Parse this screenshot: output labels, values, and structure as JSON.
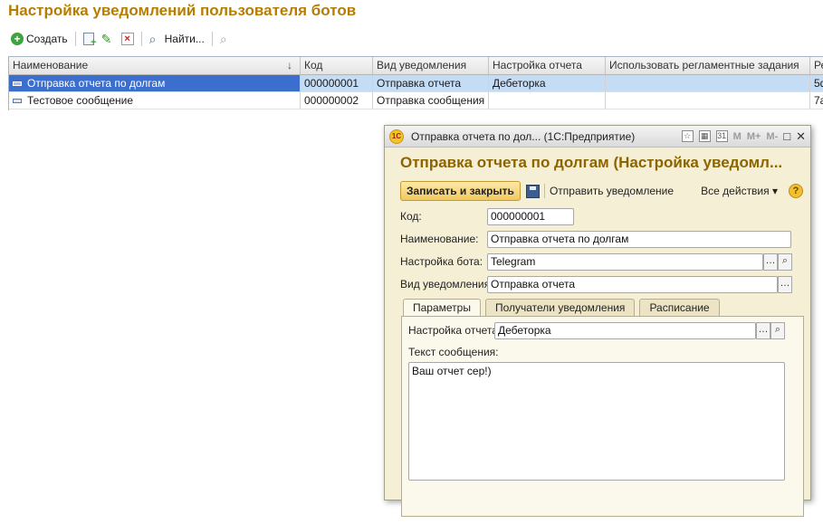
{
  "page_title": "Настройка уведомлений пользователя ботов",
  "toolbar": {
    "create_label": "Создать",
    "find_label": "Найти..."
  },
  "table": {
    "columns": [
      "Наименование",
      "Код",
      "Вид уведомления",
      "Настройка отчета",
      "Использовать регламентные задания",
      "Ре"
    ],
    "rows": [
      {
        "name": "Отправка отчета по долгам",
        "code": "000000001",
        "type": "Отправка отчета",
        "report": "Дебеторка",
        "scheduled": "",
        "extra": "5d"
      },
      {
        "name": "Тестовое сообщение",
        "code": "000000002",
        "type": "Отправка сообщения",
        "report": "",
        "scheduled": "",
        "extra": "7a"
      }
    ]
  },
  "window": {
    "title": "Отправка отчета по дол...  (1С:Предприятие)",
    "m_labels": [
      "M",
      "M+",
      "M-"
    ],
    "form_title": "Отправка отчета по долгам (Настройка уведомл...",
    "save_close_label": "Записать и закрыть",
    "send_label": "Отправить уведомление",
    "all_actions_label": "Все действия ▾",
    "help_label": "?",
    "fields": {
      "code_label": "Код:",
      "code_value": "000000001",
      "name_label": "Наименование:",
      "name_value": "Отправка отчета по долгам",
      "bot_label": "Настройка бота:",
      "bot_value": "Telegram",
      "type_label": "Вид уведомления:",
      "type_value": "Отправка отчета"
    },
    "tabs": [
      "Параметры",
      "Получатели уведомления",
      "Расписание"
    ],
    "params": {
      "report_label": "Настройка отчета:",
      "report_value": "Дебеторка",
      "message_label": "Текст сообщения:",
      "message_value": "Ваш отчет сер!)"
    }
  }
}
